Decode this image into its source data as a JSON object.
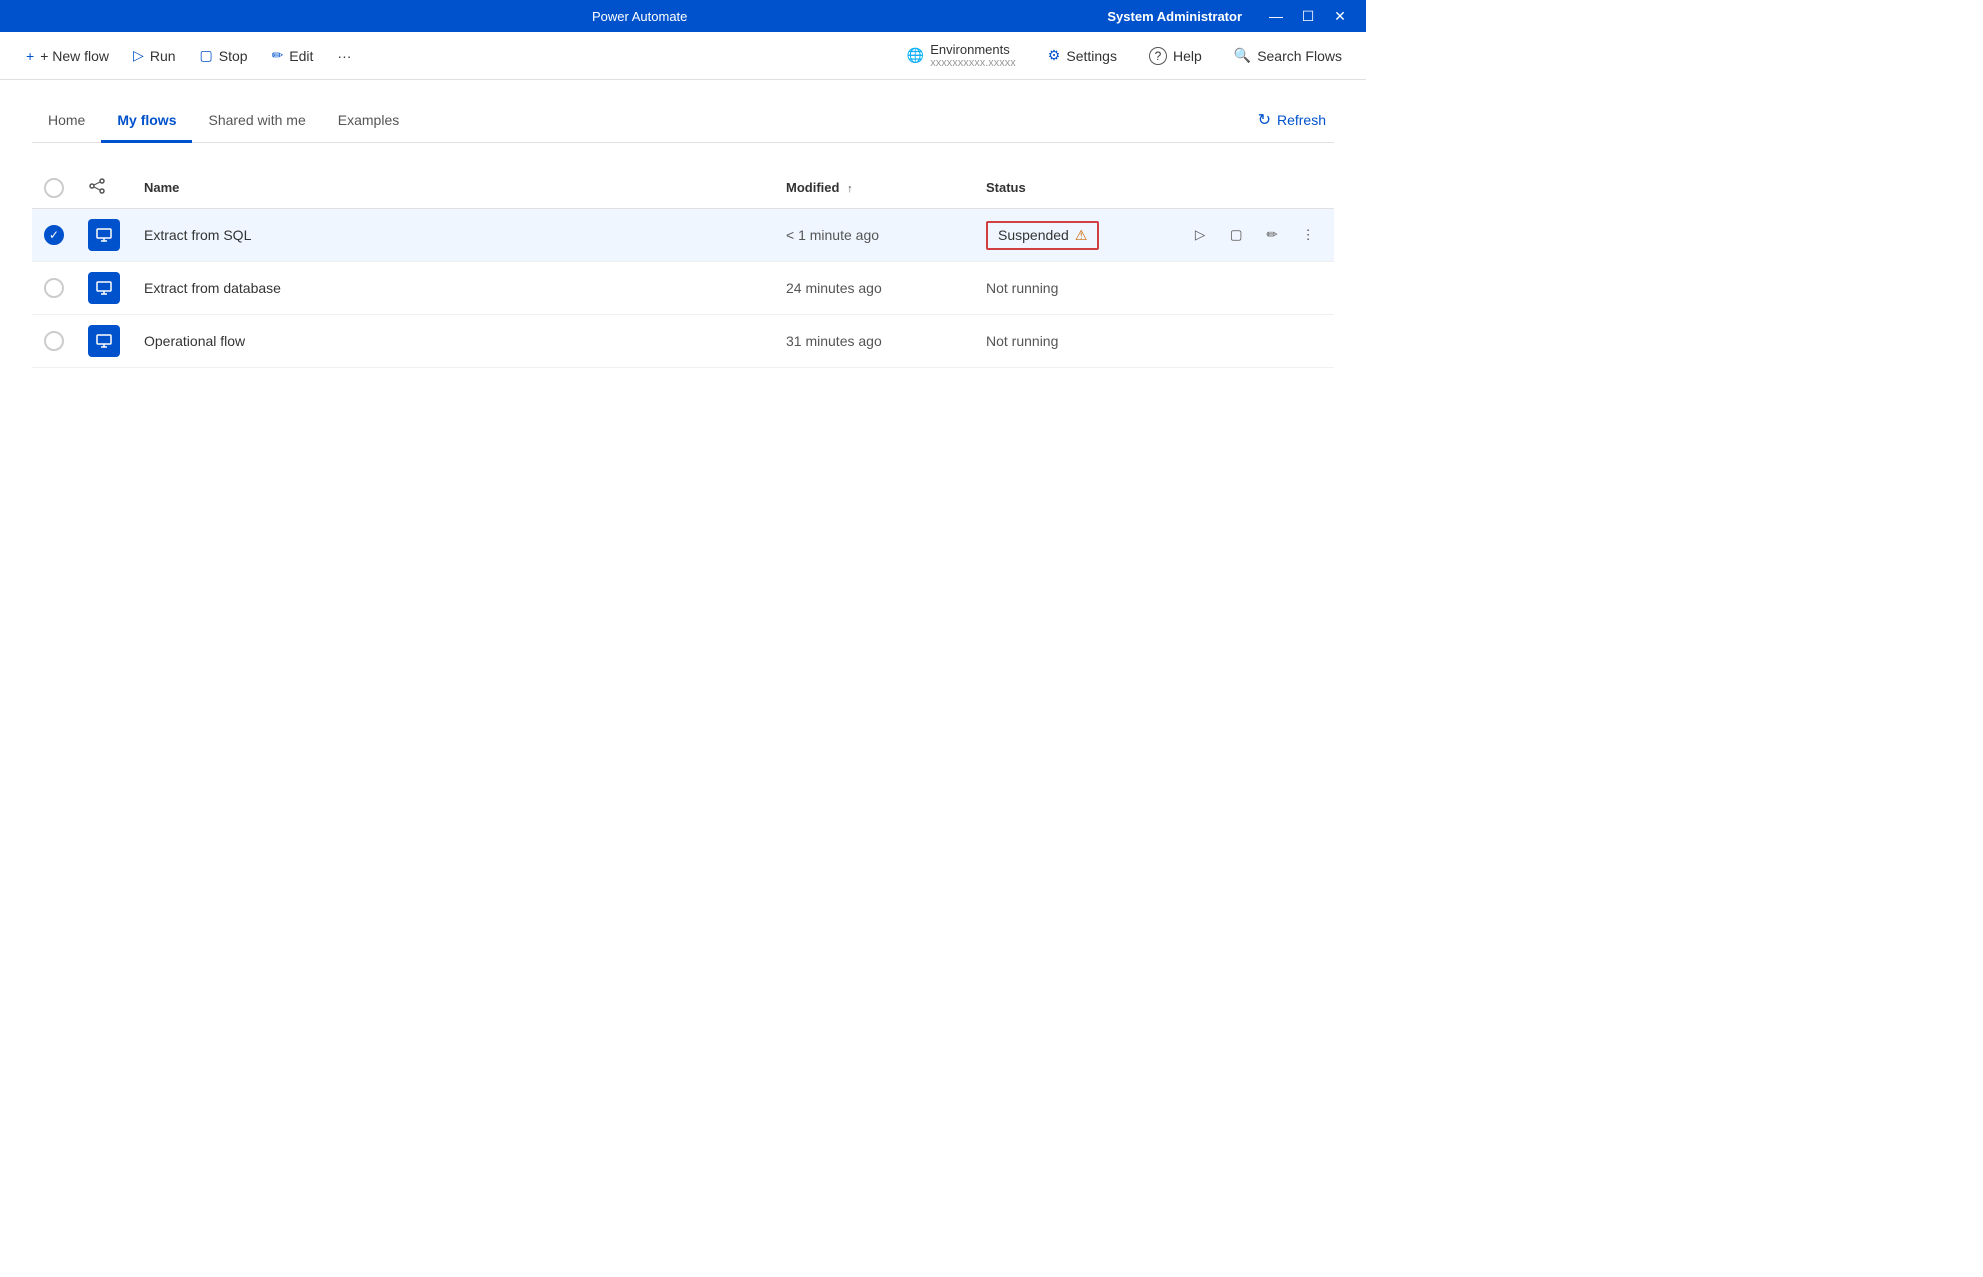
{
  "titleBar": {
    "title": "Power Automate",
    "user": "System Administrator",
    "minimize": "—",
    "restore": "☐",
    "close": "✕"
  },
  "toolbar": {
    "new_flow": "+ New flow",
    "run": "Run",
    "stop": "Stop",
    "edit": "Edit",
    "more": "···",
    "environments_label": "Environments",
    "environments_sub": "xxxxxxxxxx.xxxxx",
    "settings": "Settings",
    "help": "Help",
    "search_flows": "Search Flows"
  },
  "tabs": [
    {
      "id": "home",
      "label": "Home",
      "active": false
    },
    {
      "id": "my-flows",
      "label": "My flows",
      "active": true
    },
    {
      "id": "shared-with-me",
      "label": "Shared with me",
      "active": false
    },
    {
      "id": "examples",
      "label": "Examples",
      "active": false
    }
  ],
  "refresh_label": "Refresh",
  "table": {
    "columns": [
      {
        "id": "check",
        "label": ""
      },
      {
        "id": "icon",
        "label": ""
      },
      {
        "id": "name",
        "label": "Name"
      },
      {
        "id": "modified",
        "label": "Modified",
        "sortable": true
      },
      {
        "id": "status",
        "label": "Status"
      }
    ],
    "rows": [
      {
        "id": 1,
        "selected": true,
        "name": "Extract from SQL",
        "modified": "< 1 minute ago",
        "status": "Suspended",
        "status_type": "suspended",
        "has_actions": true
      },
      {
        "id": 2,
        "selected": false,
        "name": "Extract from database",
        "modified": "24 minutes ago",
        "status": "Not running",
        "status_type": "normal",
        "has_actions": false
      },
      {
        "id": 3,
        "selected": false,
        "name": "Operational flow",
        "modified": "31 minutes ago",
        "status": "Not running",
        "status_type": "normal",
        "has_actions": false
      }
    ]
  },
  "icons": {
    "new_flow": "+",
    "run": "▷",
    "stop": "▢",
    "edit": "✏",
    "more": "···",
    "environments": "🌐",
    "settings": "⚙",
    "help": "?",
    "search": "🔍",
    "refresh": "↻",
    "play": "▷",
    "square": "▢",
    "pencil": "✏",
    "ellipsis": "⋮",
    "warning": "⚠"
  }
}
